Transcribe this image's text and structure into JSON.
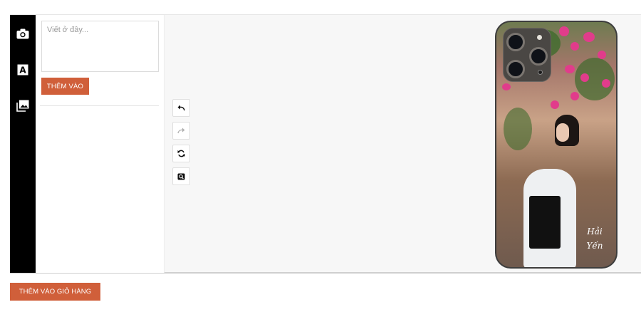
{
  "editor": {
    "toolbar": {
      "items": [
        {
          "name": "camera-icon",
          "label": ""
        },
        {
          "name": "text-tool-icon",
          "label": "A"
        },
        {
          "name": "image-gallery-icon",
          "label": ""
        }
      ]
    },
    "text_panel": {
      "placeholder": "Viết ở đây...",
      "value": "",
      "add_button_label": "THÊM VÀO"
    },
    "canvas_tools": [
      "undo-icon",
      "redo-icon",
      "rotate-icon",
      "zoom-icon"
    ],
    "preview": {
      "signature_line1": "Hải",
      "signature_line2": "Yến"
    }
  },
  "cart": {
    "add_to_cart_label": "THÊM VÀO GIỎ HÀNG"
  },
  "colors": {
    "accent": "#d05f3a",
    "toolbar": "#000000"
  }
}
